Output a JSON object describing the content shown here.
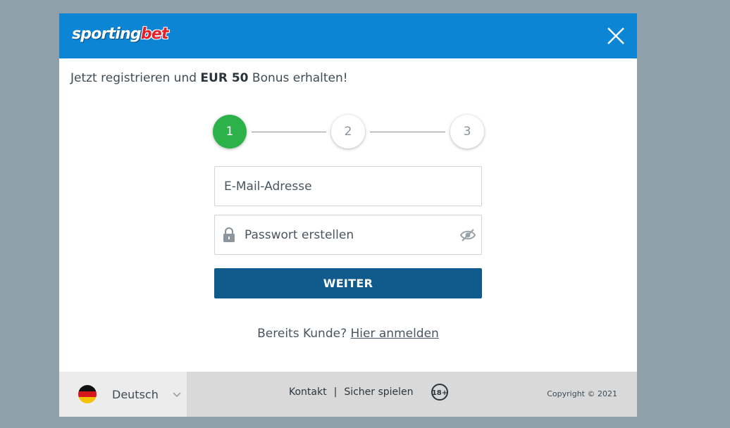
{
  "header": {
    "logo_part1": "sporting",
    "logo_part2": "bet",
    "close_icon": "close-icon"
  },
  "promo": {
    "prefix": "Jetzt registrieren und ",
    "amount": "EUR 50",
    "suffix": " Bonus erhalten!"
  },
  "stepper": {
    "steps": [
      "1",
      "2",
      "3"
    ],
    "active_step": 1,
    "active_color": "#2db24a"
  },
  "form": {
    "email_placeholder": "E-Mail-Adresse",
    "email_value": "",
    "password_placeholder": "Passwort erstellen",
    "password_value": "",
    "lock_icon": "lock-icon",
    "visibility_icon": "eye-slash-icon",
    "submit_label": "WEITER",
    "submit_color": "#105a8c"
  },
  "login": {
    "question": "Bereits Kunde? ",
    "link": "Hier anmelden"
  },
  "footer": {
    "language": "Deutsch",
    "flag_icon": "germany-flag-icon",
    "links": [
      "Kontakt",
      "Sicher spielen"
    ],
    "separator": "|",
    "age_badge": "18+",
    "copyright": "Copyright © 2021"
  },
  "colors": {
    "header_bg": "#0b85d4",
    "overlay_bg": "#8fa0ab"
  }
}
